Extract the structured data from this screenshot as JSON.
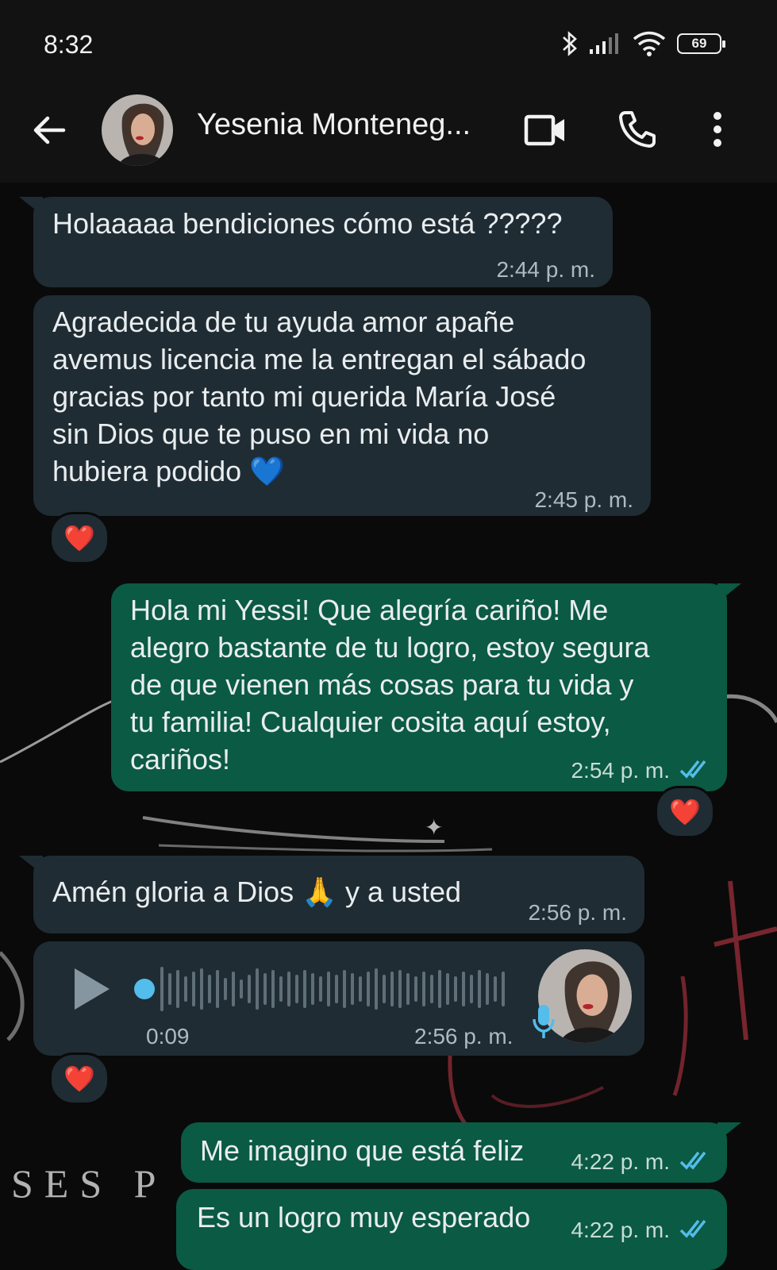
{
  "status": {
    "time": "8:32",
    "battery": "69"
  },
  "header": {
    "contact_name": "Yesenia Monteneg..."
  },
  "messages": [
    {
      "text": "Holaaaaa bendiciones cómo está ?????",
      "time": "2:44 p. m."
    },
    {
      "text": "Agradecida de tu ayuda amor apañe\navemus licencia me la entregan el sábado\ngracias por tanto mi querida María José\nsin Dios que te puso en mi vida  no\nhubiera podido 💙",
      "time": "2:45 p. m."
    },
    {
      "text": "Hola mi Yessi! Que alegría cariño! Me\nalegro bastante de tu logro, estoy segura\nde que vienen más cosas para tu vida y\ntu familia! Cualquier cosita aquí estoy,\ncariños!",
      "time": "2:54 p. m."
    },
    {
      "text": "Amén gloria a Dios 🙏 y a usted",
      "time": "2:56 p. m."
    },
    {
      "duration": "0:09",
      "time": "2:56 p. m."
    },
    {
      "text": "Me imagino que está feliz",
      "time": "4:22 p. m."
    },
    {
      "text": "Es un logro muy esperado",
      "time": "4:22 p. m."
    }
  ],
  "reaction_emoji": "❤️",
  "colors": {
    "incoming": "#1f2c33",
    "outgoing": "#0b5a43",
    "read_ticks": "#53bdeb",
    "audio_dot": "#53bdeb"
  },
  "wallpaper_text": "SES P"
}
